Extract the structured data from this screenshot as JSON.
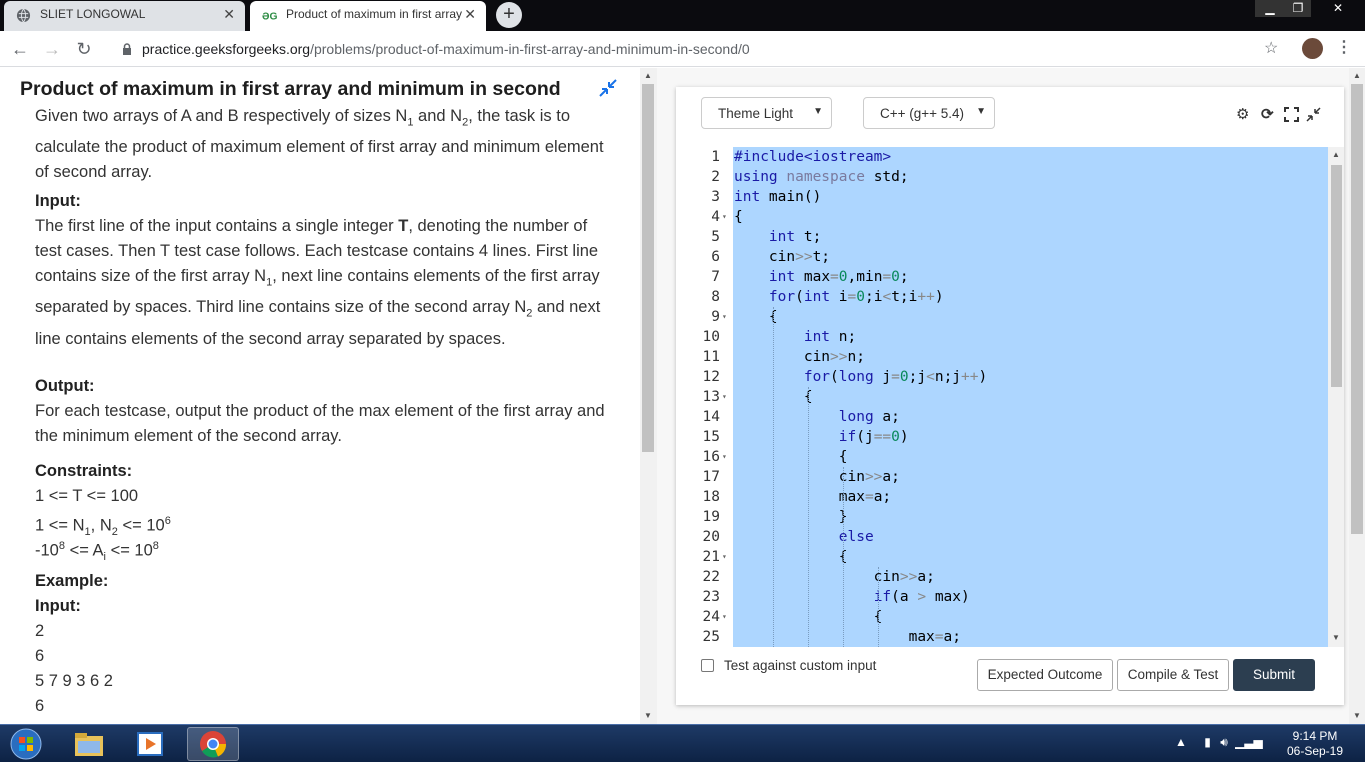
{
  "browser": {
    "tabs": [
      {
        "title": "SLIET LONGOWAL",
        "icon": "globe-icon"
      },
      {
        "title": "Product of maximum in first array",
        "icon": "gfg-logo-icon"
      }
    ],
    "new_tab_label": "+",
    "url_host": "practice.geeksforgeeks.org",
    "url_path": "/problems/product-of-maximum-in-first-array-and-minimum-in-second/0"
  },
  "problem": {
    "title": "Product of maximum in first array and minimum in second",
    "description": [
      "Given two arrays of A and B respectively of sizes N",
      "1",
      " and N",
      "2",
      ", the task is to calculate the product of maximum element of first array and minimum element of second array."
    ],
    "input_heading": "Input:",
    "input_text": [
      "The first line of the input contains a single integer ",
      "T",
      ", denoting the number of test cases. Then T test case follows. Each testcase contains 4 lines. First line contains size of the first array N",
      "1",
      ", next line contains elements of the first array separated by spaces. Third line contains size of the second array N",
      "2",
      " and next line contains elements of the second array separated by spaces."
    ],
    "output_heading": "Output:",
    "output_text": "For each testcase, output the product of the max element of the first array and the minimum element of the second array.",
    "constraints_heading": "Constraints:",
    "constraint1": "1 <= T <= 100",
    "constraint2": [
      "1 <= N",
      "1",
      ", N",
      "2",
      " <= 10",
      "6"
    ],
    "constraint3": [
      "-10",
      "8",
      " <= A",
      "i",
      " <= 10",
      "8"
    ],
    "example_heading": "Example:",
    "example_input_heading": "Input:",
    "example_lines": [
      "2",
      "6",
      "5 7 9 3 6 2",
      "6"
    ]
  },
  "editor": {
    "theme_select": "Theme Light",
    "language_select": "C++ (g++ 5.4)",
    "line_numbers": [
      "1",
      "2",
      "3",
      "4",
      "5",
      "6",
      "7",
      "8",
      "9",
      "10",
      "11",
      "12",
      "13",
      "14",
      "15",
      "16",
      "17",
      "18",
      "19",
      "20",
      "21",
      "22",
      "23",
      "24",
      "25"
    ],
    "code": [
      "#include<iostream>",
      "using namespace std;",
      "int main()",
      "{",
      "    int t;",
      "    cin>>t;",
      "    int max=0,min=0;",
      "    for(int i=0;i<t;i++)",
      "    {",
      "        int n;",
      "        cin>>n;",
      "        for(long j=0;j<n;j++)",
      "        {",
      "            long a;",
      "            if(j==0)",
      "            {",
      "            cin>>a;",
      "            max=a;",
      "            }",
      "            else",
      "            {",
      "                cin>>a;",
      "                if(a > max)",
      "                {",
      "                    max=a;"
    ],
    "custom_input_label": "Test against custom input",
    "expected_outcome_label": "Expected Outcome",
    "compile_test_label": "Compile & Test",
    "submit_label": "Submit"
  },
  "taskbar": {
    "time": "9:14 PM",
    "date": "06-Sep-19"
  }
}
